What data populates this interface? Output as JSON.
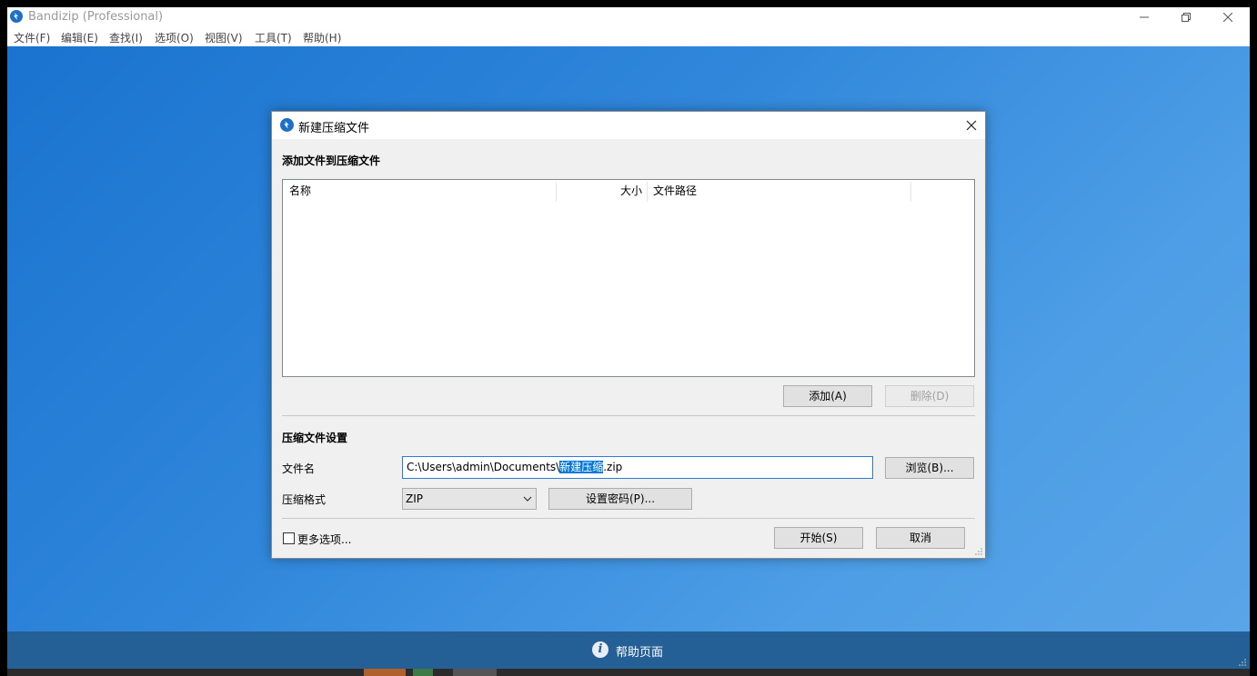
{
  "window": {
    "title": "Bandizip (Professional)",
    "menu": [
      "文件(F)",
      "编辑(E)",
      "查找(I)",
      "选项(O)",
      "视图(V)",
      "工具(T)",
      "帮助(H)"
    ]
  },
  "help_bar": {
    "label": "帮助页面",
    "icon": "info-icon"
  },
  "dialog": {
    "title": "新建压缩文件",
    "add_section_title": "添加文件到压缩文件",
    "columns": {
      "name": "名称",
      "size": "大小",
      "path": "文件路径"
    },
    "add_button": "添加(A)",
    "delete_button": "删除(D)",
    "settings_section_title": "压缩文件设置",
    "filename_label": "文件名",
    "filename": {
      "prefix": "C:\\Users\\admin\\Documents\\",
      "selected": "新建压缩",
      "suffix": ".zip"
    },
    "browse_button": "浏览(B)...",
    "format_label": "压缩格式",
    "format_value": "ZIP",
    "password_button": "设置密码(P)...",
    "more_options_label": "更多选项...",
    "more_options_checked": false,
    "start_button": "开始(S)",
    "cancel_button": "取消"
  },
  "colors": {
    "desktop": "#2f86da",
    "help_bar": "#245f95",
    "selection": "#0078d7",
    "focus_border": "#2a7bd6"
  }
}
